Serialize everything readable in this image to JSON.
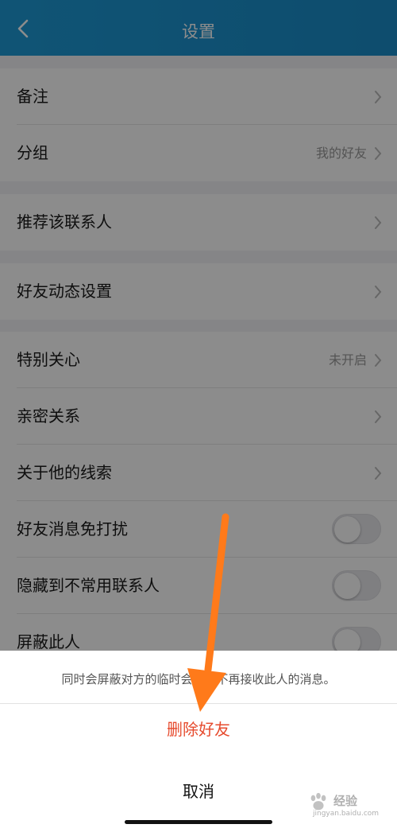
{
  "nav": {
    "title": "设置",
    "back_icon": "chevron-left-icon"
  },
  "groups": [
    {
      "rows": [
        {
          "label": "备注",
          "value": "",
          "accessory": "chevron"
        },
        {
          "label": "分组",
          "value": "我的好友",
          "accessory": "chevron"
        }
      ]
    },
    {
      "rows": [
        {
          "label": "推荐该联系人",
          "value": "",
          "accessory": "chevron"
        }
      ]
    },
    {
      "rows": [
        {
          "label": "好友动态设置",
          "value": "",
          "accessory": "chevron"
        }
      ]
    },
    {
      "rows": [
        {
          "label": "特别关心",
          "value": "未开启",
          "accessory": "chevron"
        },
        {
          "label": "亲密关系",
          "value": "",
          "accessory": "chevron"
        },
        {
          "label": "关于他的线索",
          "value": "",
          "accessory": "chevron"
        },
        {
          "label": "好友消息免打扰",
          "value": "",
          "accessory": "toggle",
          "on": false
        },
        {
          "label": "隐藏到不常用联系人",
          "value": "",
          "accessory": "toggle",
          "on": false
        },
        {
          "label": "屏蔽此人",
          "value": "",
          "accessory": "toggle",
          "on": false
        }
      ]
    }
  ],
  "action_sheet": {
    "notice": "同时会屏蔽对方的临时会话，不再接收此人的消息。",
    "delete_label": "删除好友",
    "cancel_label": "取消"
  },
  "watermark": {
    "text": "经验",
    "sub": "jingyan.baidu.com",
    "icon": "baidu-paw-icon"
  },
  "colors": {
    "nav": "#1e9ad6",
    "destructive": "#e64a2d",
    "annotation_arrow": "#ff7a1a"
  }
}
